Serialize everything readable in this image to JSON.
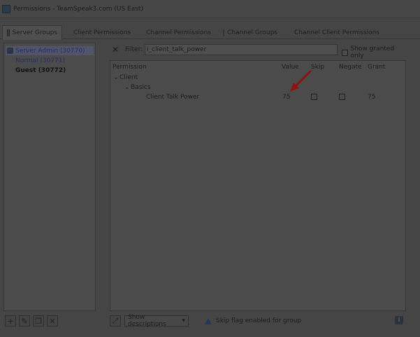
{
  "window": {
    "title": "Permissions - TeamSpeak3.com (US East)"
  },
  "tabs": [
    {
      "label": "Server Groups",
      "icon": "server-groups-icon"
    },
    {
      "label": "Client Permissions",
      "icon": "user-icon"
    },
    {
      "label": "Channel Permissions",
      "icon": "channel-icon"
    },
    {
      "label": "Channel Groups",
      "icon": "channel-icon"
    },
    {
      "label": "Channel Client Permissions",
      "icon": "user-icon"
    }
  ],
  "groups": [
    {
      "label": "Server Admin (30770)"
    },
    {
      "label": "Normal (30771)"
    },
    {
      "label": "Guest (30772)"
    }
  ],
  "filter": {
    "label": "Filter:",
    "value": "i_client_talk_power",
    "show_granted": "Show granted only"
  },
  "columns": {
    "permission": "Permission",
    "value": "Value",
    "skip": "Skip",
    "negate": "Negate",
    "grant": "Grant"
  },
  "tree": {
    "category": "Client",
    "subcategory": "Basics",
    "row": {
      "name": "Client Talk Power",
      "value": "75",
      "grant": "75"
    }
  },
  "bottom": {
    "descriptions": "Show descriptions",
    "status": "Skip flag enabled for group"
  },
  "colors": {
    "accent_arrow": "#8a1414",
    "link_blue": "#252b6e"
  }
}
